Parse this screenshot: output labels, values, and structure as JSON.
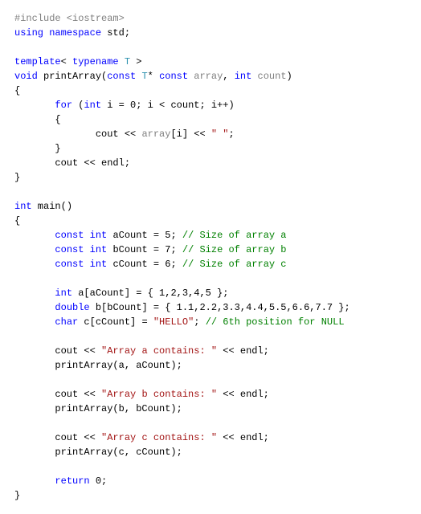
{
  "code": {
    "l1_pp": "#include <iostream>",
    "l2_kw1": "using",
    "l2_kw2": "namespace",
    "l2_id": " std;",
    "l3": "",
    "l4_kw": "template",
    "l4_op1": "< ",
    "l4_kw2": "typename",
    "l4_ty": " T",
    "l4_op2": " >",
    "l5_kw": "void",
    "l5_fn": " printArray(",
    "l5_kw2": "const",
    "l5_ty": " T",
    "l5_rest1": "* ",
    "l5_kw3": "const",
    "l5_param1": " array",
    "l5_rest2": ", ",
    "l5_kw4": "int",
    "l5_param2": " count",
    "l5_rest3": ")",
    "l6": "{",
    "l7_a": "       ",
    "l7_kw": "for",
    "l7_b": " (",
    "l7_kw2": "int",
    "l7_c": " i = 0; i < count; i++)",
    "l8": "       {",
    "l9_a": "              cout << ",
    "l9_b": "array",
    "l9_c": "[i] << ",
    "l9_str": "\" \"",
    "l9_d": ";",
    "l10": "       }",
    "l11": "       cout << endl;",
    "l12": "}",
    "l13": "",
    "l14_kw": "int",
    "l14_fn": " main()",
    "l15": "{",
    "l16_a": "       ",
    "l16_kw": "const",
    "l16_b": " ",
    "l16_kw2": "int",
    "l16_c": " aCount = 5; ",
    "l16_cmt": "// Size of array a",
    "l17_a": "       ",
    "l17_kw": "const",
    "l17_b": " ",
    "l17_kw2": "int",
    "l17_c": " bCount = 7; ",
    "l17_cmt": "// Size of array b",
    "l18_a": "       ",
    "l18_kw": "const",
    "l18_b": " ",
    "l18_kw2": "int",
    "l18_c": " cCount = 6; ",
    "l18_cmt": "// Size of array c",
    "l19": "",
    "l20_a": "       ",
    "l20_kw": "int",
    "l20_b": " a[aCount] = { 1,2,3,4,5 };",
    "l21_a": "       ",
    "l21_kw": "double",
    "l21_b": " b[bCount] = { 1.1,2.2,3.3,4.4,5.5,6.6,7.7 };",
    "l22_a": "       ",
    "l22_kw": "char",
    "l22_b": " c[cCount] = ",
    "l22_str": "\"HELLO\"",
    "l22_c": "; ",
    "l22_cmt": "// 6th position for NULL",
    "l23": "",
    "l24_a": "       cout << ",
    "l24_str": "\"Array a contains: \"",
    "l24_b": " << endl;",
    "l25": "       printArray(a, aCount);",
    "l26": "",
    "l27_a": "       cout << ",
    "l27_str": "\"Array b contains: \"",
    "l27_b": " << endl;",
    "l28": "       printArray(b, bCount);",
    "l29": "",
    "l30_a": "       cout << ",
    "l30_str": "\"Array c contains: \"",
    "l30_b": " << endl;",
    "l31": "       printArray(c, cCount);",
    "l32": "",
    "l33_a": "       ",
    "l33_kw": "return",
    "l33_b": " 0;",
    "l34": "}"
  },
  "chart_data": {
    "type": "table",
    "title": "C++ Function Template printArray source code",
    "language": "cpp",
    "lines": [
      "#include <iostream>",
      "using namespace std;",
      "",
      "template< typename T >",
      "void printArray(const T* const array, int count)",
      "{",
      "       for (int i = 0; i < count; i++)",
      "       {",
      "              cout << array[i] << \" \";",
      "       }",
      "       cout << endl;",
      "}",
      "",
      "int main()",
      "{",
      "       const int aCount = 5; // Size of array a",
      "       const int bCount = 7; // Size of array b",
      "       const int cCount = 6; // Size of array c",
      "",
      "       int a[aCount] = { 1,2,3,4,5 };",
      "       double b[bCount] = { 1.1,2.2,3.3,4.4,5.5,6.6,7.7 };",
      "       char c[cCount] = \"HELLO\"; // 6th position for NULL",
      "",
      "       cout << \"Array a contains: \" << endl;",
      "       printArray(a, aCount);",
      "",
      "       cout << \"Array b contains: \" << endl;",
      "       printArray(b, bCount);",
      "",
      "       cout << \"Array c contains: \" << endl;",
      "       printArray(c, cCount);",
      "",
      "       return 0;",
      "}"
    ]
  }
}
